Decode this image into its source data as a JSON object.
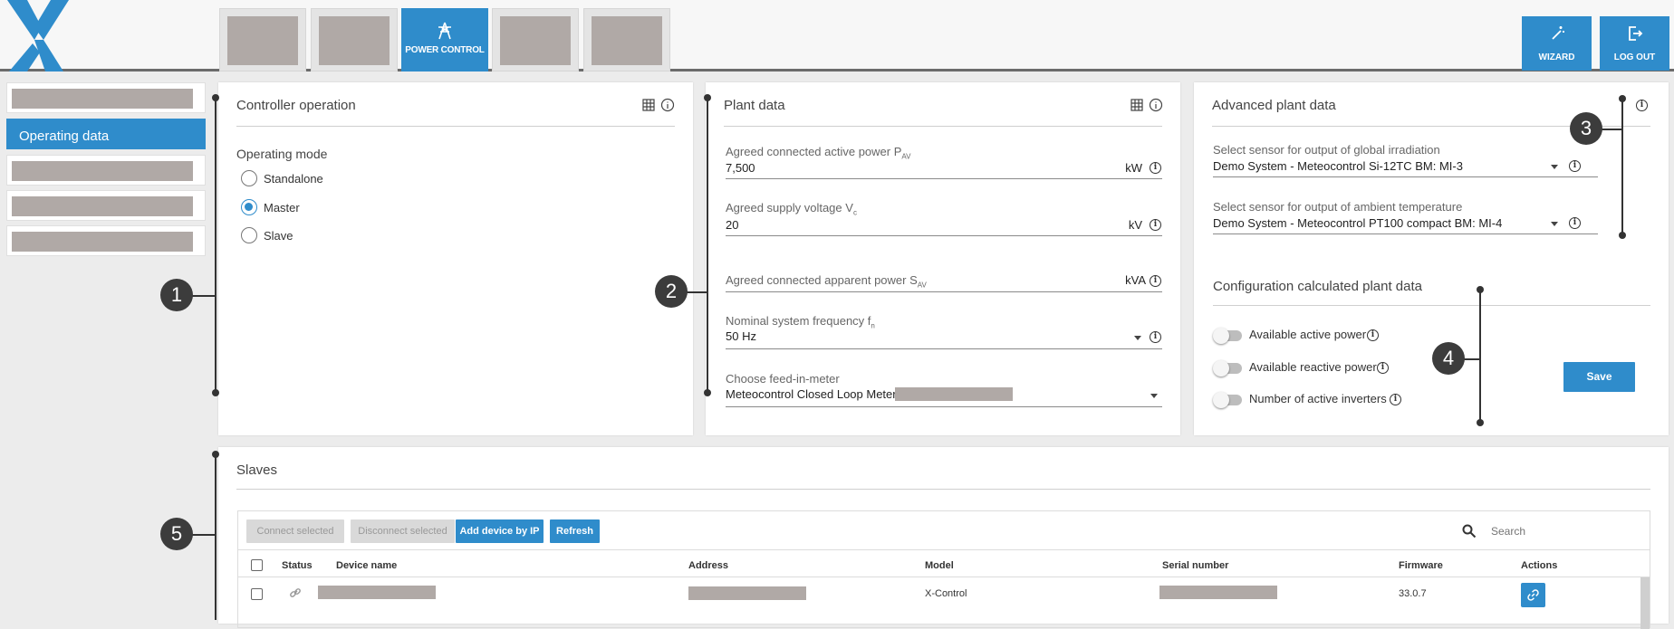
{
  "nav": {
    "active_tab_label": "POWER CONTROL",
    "wizard_label": "WIZARD",
    "logout_label": "LOG OUT"
  },
  "sidebar": {
    "active_label": "Operating data"
  },
  "controller": {
    "title": "Controller operation",
    "mode_label": "Operating mode",
    "options": [
      "Standalone",
      "Master",
      "Slave"
    ],
    "selected": "Master"
  },
  "plant": {
    "title": "Plant data",
    "active_power_label": "Agreed connected active power P",
    "active_power_sub": "AV",
    "active_power_value": "7,500",
    "active_power_unit": "kW",
    "voltage_label": "Agreed supply voltage V",
    "voltage_sub": "c",
    "voltage_value": "20",
    "voltage_unit": "kV",
    "apparent_label": "Agreed connected apparent power S",
    "apparent_sub": "AV",
    "apparent_unit": "kVA",
    "freq_label": "Nominal system frequency f",
    "freq_sub": "n",
    "freq_value": "50 Hz",
    "meter_label": "Choose feed-in-meter",
    "meter_value": "Meteocontrol Closed Loop Meter"
  },
  "advanced": {
    "title": "Advanced plant data",
    "irr_label": "Select sensor for output of global irradiation",
    "irr_value": "Demo System - Meteocontrol Si-12TC BM: MI-3",
    "temp_label": "Select sensor for output of ambient temperature",
    "temp_value": "Demo System - Meteocontrol PT100 compact BM: MI-4",
    "config_title": "Configuration calculated plant data",
    "toggles": [
      "Available active power",
      "Available reactive power",
      "Number of active inverters"
    ],
    "save_label": "Save"
  },
  "slaves": {
    "title": "Slaves",
    "connect_label": "Connect selected",
    "disconnect_label": "Disconnect selected",
    "add_label": "Add device by IP",
    "refresh_label": "Refresh",
    "search_placeholder": "Search",
    "columns": [
      "Status",
      "Device name",
      "Address",
      "Model",
      "Serial number",
      "Firmware",
      "Actions"
    ],
    "rows": [
      {
        "model": "X-Control",
        "firmware": "33.0.7"
      }
    ]
  },
  "annotations": [
    "1",
    "2",
    "3",
    "4",
    "5"
  ],
  "colors": {
    "accent": "#2f8ccb",
    "placeholder": "#b0a9a6"
  }
}
